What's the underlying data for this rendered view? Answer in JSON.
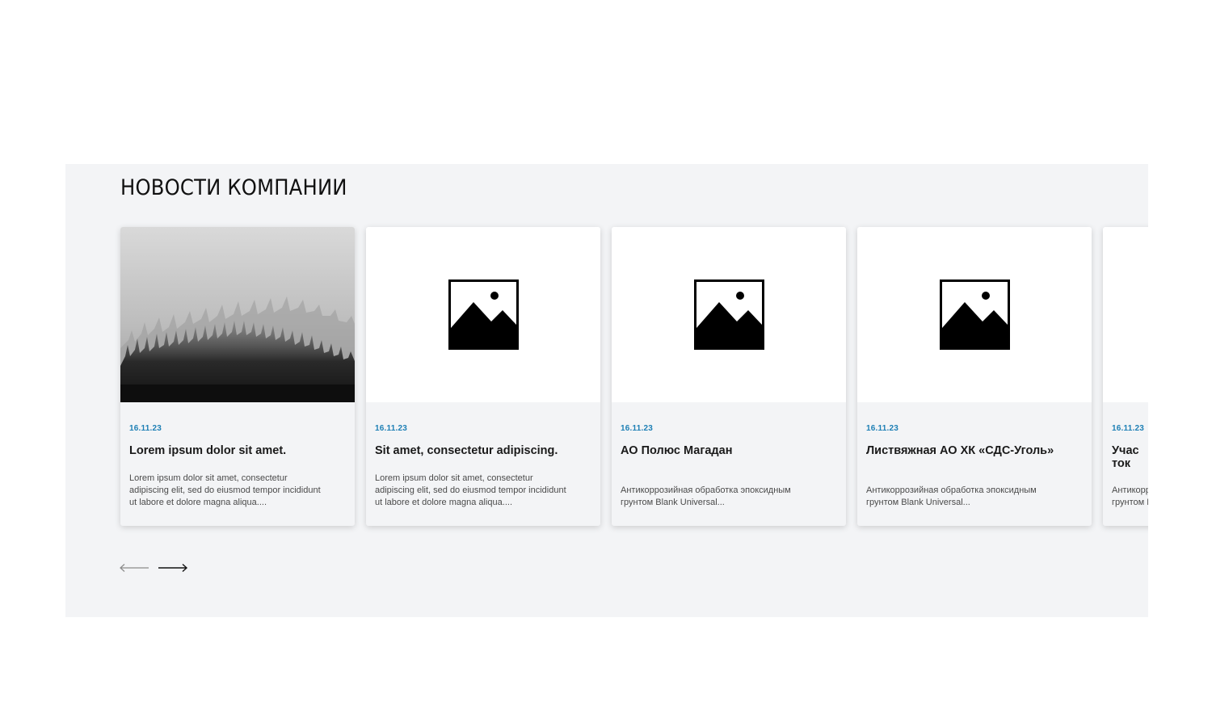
{
  "section": {
    "title": "НОВОСТИ КОМПАНИИ"
  },
  "news": [
    {
      "date": "16.11.23",
      "title": "Lorem ipsum dolor sit amet.",
      "text": "Lorem ipsum dolor sit amet, consectetur\nadipiscing elit, sed do eiusmod tempor incididunt\nut labore et dolore magna aliqua....",
      "image": "forest-photo"
    },
    {
      "date": "16.11.23",
      "title": "Sit amet, consectetur adipiscing.",
      "text": "Lorem ipsum dolor sit amet, consectetur\nadipiscing elit, sed do eiusmod tempor incididunt\nut labore et dolore magna aliqua....",
      "image": "image-placeholder-icon"
    },
    {
      "date": "16.11.23",
      "title": "АО Полюс Магадан",
      "text": "\nАнтикоррозийная обработка эпоксидным\nгрунтом Blank Universal...",
      "image": "image-placeholder-icon"
    },
    {
      "date": "16.11.23",
      "title": "Листвяжная АО ХК «СДС-Уголь»",
      "text": "\nАнтикоррозийная обработка эпоксидным\nгрунтом Blank Universal...",
      "image": "image-placeholder-icon"
    },
    {
      "date": "16.11.23",
      "title": "Участок ОК На",
      "text": "\nАнтикоррозийная обработка эпоксидным\nгрунтом Blank Universal...",
      "image": "image-placeholder-icon"
    }
  ],
  "navigation": {
    "prev_icon": "arrow-left-icon",
    "next_icon": "arrow-right-icon",
    "prev_color": "#8a8a8a",
    "next_color": "#111111"
  },
  "colors": {
    "section_background": "#f3f4f6",
    "date_accent": "#1d7fb5",
    "title_text": "#1a1a1a"
  }
}
